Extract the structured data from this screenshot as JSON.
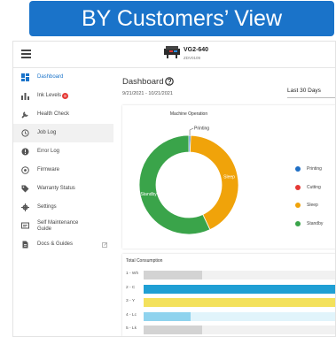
{
  "banner": {
    "title": "BY Customers’ View"
  },
  "header": {
    "model": "VG2-640",
    "serial": "ZDV0109"
  },
  "sidebar": {
    "items": [
      {
        "label": "Dashboard",
        "icon": "dashboard-icon"
      },
      {
        "label": "Ink Levels",
        "icon": "bar-chart-icon",
        "badge": "8"
      },
      {
        "label": "Health Check",
        "icon": "wrench-icon"
      },
      {
        "label": "Job Log",
        "icon": "history-icon"
      },
      {
        "label": "Error Log",
        "icon": "alert-icon"
      },
      {
        "label": "Firmware",
        "icon": "firmware-icon"
      },
      {
        "label": "Warranty Status",
        "icon": "tag-icon"
      },
      {
        "label": "Settings",
        "icon": "gear-icon"
      },
      {
        "label": "Self Maintenance Guide",
        "icon": "guide-icon"
      },
      {
        "label": "Docs & Guides",
        "icon": "document-icon"
      }
    ]
  },
  "main": {
    "title": "Dashboard",
    "date_range": "9/21/2021 - 10/21/2021",
    "period": "Last 30 Days"
  },
  "chart_data": {
    "type": "pie",
    "title": "Machine Operation",
    "categories": [
      "Printing",
      "Cutting",
      "Sleep",
      "Standby"
    ],
    "values": [
      0.6,
      0,
      42.4,
      57
    ],
    "colors": [
      "#1f6fc5",
      "#e53935",
      "#f0a30a",
      "#3aa44a"
    ],
    "slice_labels": [
      "Printing",
      "",
      "Sleep",
      "Standby"
    ],
    "legend": "right"
  },
  "consumption": {
    "title": "Total Consumption",
    "rows": [
      {
        "label": "1 - Wh",
        "level": 0.3,
        "color": "#d3d3d3",
        "track": "#f1f1f1"
      },
      {
        "label": "2 - C",
        "level": 0.98,
        "color": "#1f9fd4",
        "track": "#c7ecf7"
      },
      {
        "label": "3 - Y",
        "level": 0.98,
        "color": "#f3e15c",
        "track": "#fbf4c6"
      },
      {
        "label": "4 - Lc",
        "level": 0.24,
        "color": "#8fd3ee",
        "track": "#e1f4fb"
      },
      {
        "label": "5 - Lk",
        "level": 0.3,
        "color": "#d3d3d3",
        "track": "#f1f1f1"
      }
    ]
  }
}
